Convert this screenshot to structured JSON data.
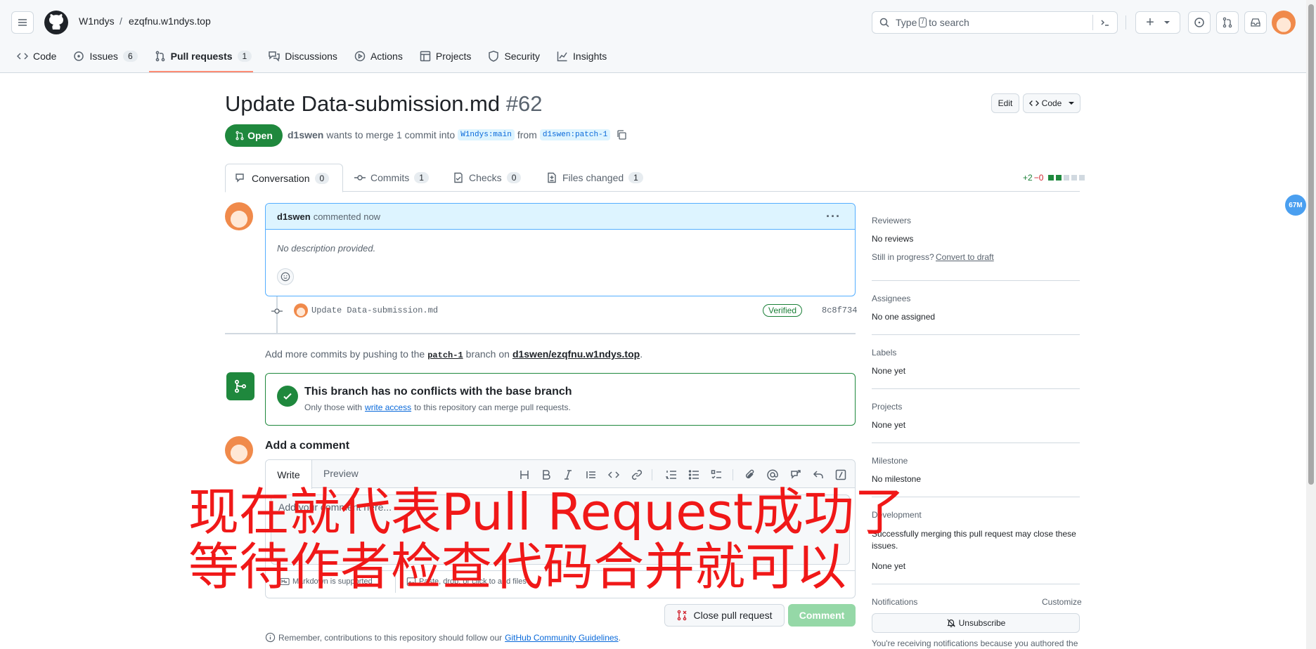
{
  "header": {
    "owner": "W1ndys",
    "separator": "/",
    "repo": "ezqfnu.w1ndys.top",
    "search_placeholder_pre": "Type",
    "search_key": "/",
    "search_placeholder_post": "to search",
    "plus_label": "+"
  },
  "repo_tabs": [
    {
      "label": "Code",
      "icon": "code-icon"
    },
    {
      "label": "Issues",
      "count": "6",
      "icon": "issue-icon"
    },
    {
      "label": "Pull requests",
      "count": "1",
      "icon": "pull-request-icon"
    },
    {
      "label": "Discussions",
      "icon": "discussion-icon"
    },
    {
      "label": "Actions",
      "icon": "play-icon"
    },
    {
      "label": "Projects",
      "icon": "table-icon"
    },
    {
      "label": "Security",
      "icon": "shield-icon"
    },
    {
      "label": "Insights",
      "icon": "graph-icon"
    }
  ],
  "pr": {
    "title": "Update Data-submission.md",
    "number": "#62",
    "edit_label": "Edit",
    "code_label": "Code",
    "state": "Open",
    "author": "d1swen",
    "meta_text": "wants to merge 1 commit into",
    "base_branch": "W1ndys:main",
    "from_text": "from",
    "head_branch": "d1swen:patch-1"
  },
  "pr_tabs": [
    {
      "label": "Conversation",
      "count": "0"
    },
    {
      "label": "Commits",
      "count": "1"
    },
    {
      "label": "Checks",
      "count": "0"
    },
    {
      "label": "Files changed",
      "count": "1"
    }
  ],
  "diffstat": {
    "additions": "+2",
    "deletions": "−0"
  },
  "comment": {
    "author": "d1swen",
    "action": "commented now",
    "body": "No description provided.",
    "more_label": "···"
  },
  "commit": {
    "message": "Update Data-submission.md",
    "verified": "Verified",
    "sha": "8c8f734"
  },
  "push_hint": {
    "pre": "Add more commits by pushing to the",
    "branch": "patch-1",
    "mid": "branch on",
    "repo": "d1swen/ezqfnu.w1ndys.top",
    "post": "."
  },
  "merge": {
    "title": "This branch has no conflicts with the base branch",
    "sub_pre": "Only those with",
    "sub_link": "write access",
    "sub_post": "to this repository can merge pull requests."
  },
  "add_comment": {
    "heading": "Add a comment",
    "write_tab": "Write",
    "preview_tab": "Preview",
    "placeholder": "Add your comment here...",
    "markdown_hint": "Markdown is supported",
    "attach_hint": "Paste, drop, or click to add files",
    "close_label": "Close pull request",
    "comment_label": "Comment"
  },
  "footer_note": {
    "pre": "Remember, contributions to this repository should follow our",
    "link": "GitHub Community Guidelines",
    "post": "."
  },
  "sidebar": {
    "reviewers_label": "Reviewers",
    "reviewers_value": "No reviews",
    "in_progress": "Still in progress?",
    "convert_link": "Convert to draft",
    "assignees_label": "Assignees",
    "assignees_value": "No one assigned",
    "labels_label": "Labels",
    "labels_value": "None yet",
    "projects_label": "Projects",
    "projects_value": "None yet",
    "milestone_label": "Milestone",
    "milestone_value": "No milestone",
    "development_label": "Development",
    "development_text": "Successfully merging this pull request may close these issues.",
    "development_value": "None yet",
    "notifications_label": "Notifications",
    "customize": "Customize",
    "unsubscribe": "Unsubscribe",
    "notif_reason": "You're receiving notifications because you authored the"
  },
  "floating_badge": "67M",
  "overlay": {
    "line1": "现在就代表Pull Request成功了",
    "line2": "等待作者检查代码合并就可以"
  },
  "colors": {
    "accent": "#0969da",
    "success": "#1f883d",
    "danger": "#d1242f",
    "overlay_text": "#f01818"
  }
}
